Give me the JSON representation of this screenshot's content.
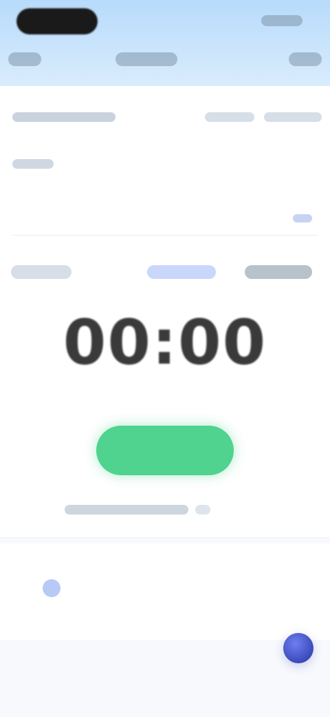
{
  "timer": {
    "value": "00:00"
  },
  "actions": {
    "start_label": ""
  }
}
